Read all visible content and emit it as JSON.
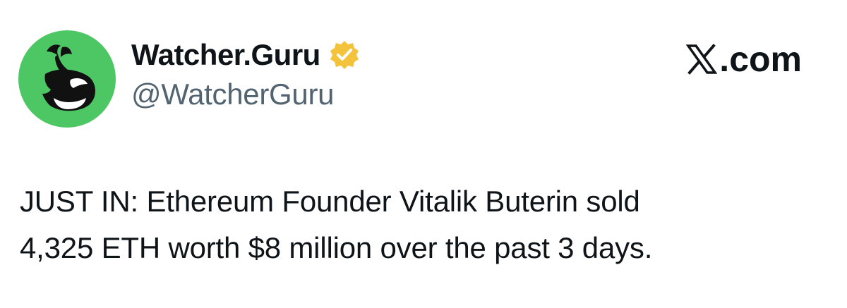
{
  "author": {
    "display_name": "Watcher.Guru",
    "handle": "@WatcherGuru",
    "verified_badge_color": "#f4c33c",
    "avatar_background": "#4cc764",
    "avatar_icon": "whale-icon"
  },
  "brand": {
    "domain_suffix": ".com",
    "logo_icon": "x-logo-icon"
  },
  "tweet": {
    "lines": [
      "JUST IN: Ethereum Founder Vitalik Buterin sold",
      "4,325 ETH worth $8 million over the past 3 days."
    ]
  },
  "colors": {
    "text_primary": "#0f1419",
    "text_secondary": "#536471",
    "background": "#ffffff"
  }
}
